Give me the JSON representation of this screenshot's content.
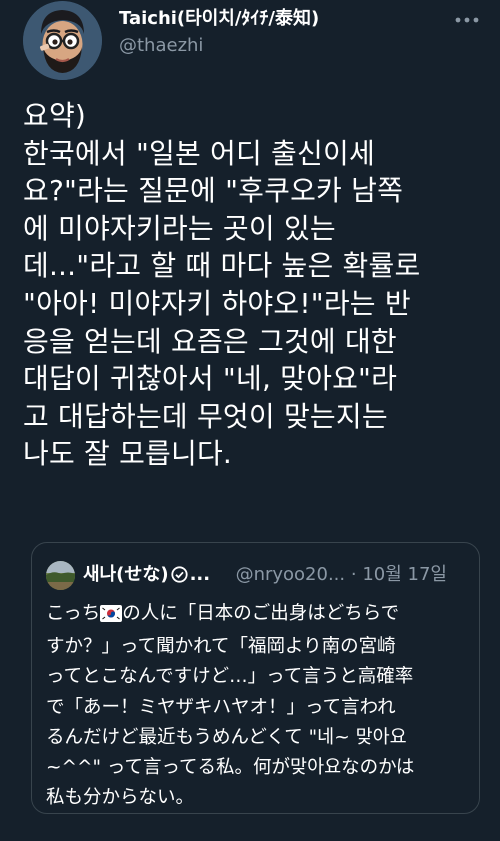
{
  "author": {
    "display_name": "Taichi(타이치/ﾀｲﾁ/泰知)",
    "handle": "@thaezhi",
    "avatar_icon": "cartoon-man-avatar-icon"
  },
  "tweet": {
    "text": "요약)\n한국에서 \"일본 어디 출신이세\n요?\"라는 질문에 \"후쿠오카 남쪽\n에 미야자키라는 곳이 있는\n데...\"라고 할 때 마다 높은 확률로\n\"아아! 미야자키 하야오!\"라는 반\n응을 얻는데 요즘은 그것에 대한\n대답이 귀찮아서 \"네, 맞아요\"라\n고 대답하는데 무엇이 맞는지는\n나도 잘 모릅니다."
  },
  "quote": {
    "name": "새나(せな)",
    "name_truncation": "...",
    "handle": "@nryoo20...",
    "separator": "·",
    "date": "10월 17일",
    "text_before_flag": "こっち",
    "flag_icon": "south-korea-flag-icon",
    "text_after_flag": "の人に「日本のご出身はどちらで\nすか？」って聞かれて「福岡より南の宮崎\nってとこなんですけど…」って言うと高確率\nで「あー！ミヤザキハヤオ！」って言われ\nるんだけど最近もうめんどくて \"네~ 맞아요\n~^^\" って言ってる私。何が맞아요なのかは\n私も分からない。"
  },
  "colors": {
    "background": "#15202b",
    "text": "#ffffff",
    "muted": "#8b98a5",
    "border": "#38444d"
  }
}
